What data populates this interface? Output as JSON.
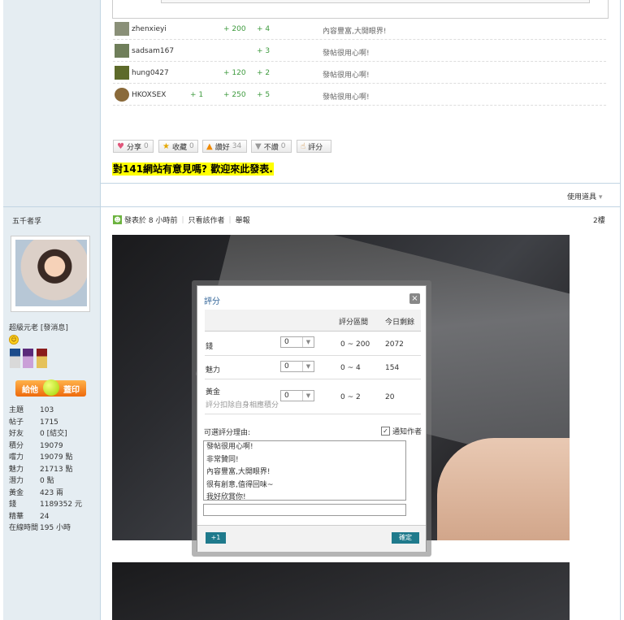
{
  "rating_rows": [
    {
      "name": "zhenxieyi",
      "c1": "",
      "c2": "+ 200",
      "c3": "+ 4",
      "reason": "內容豐富,大開眼界!",
      "avatar_color": "#8a9078"
    },
    {
      "name": "sadsam167",
      "c1": "",
      "c2": "",
      "c3": "+ 3",
      "reason": "發帖很用心啊!",
      "avatar_color": "#6f7e5a"
    },
    {
      "name": "hung0427",
      "c1": "",
      "c2": "+ 120",
      "c3": "+ 2",
      "reason": "發帖很用心啊!",
      "avatar_color": "#5d6a2a"
    },
    {
      "name": "HKOXSEX",
      "c1": "+ 1",
      "c2": "+ 250",
      "c3": "+ 5",
      "reason": "發帖很用心啊!",
      "avatar_color": "#8a6a3a"
    }
  ],
  "actions": {
    "share": {
      "label": "分享",
      "count": "0"
    },
    "favorite": {
      "label": "收藏",
      "count": "0"
    },
    "like": {
      "label": "讚好",
      "count": "34"
    },
    "dislike": {
      "label": "不讚",
      "count": "0"
    },
    "rate": {
      "label": "評分"
    }
  },
  "banner": "對141網站有意見嗎? 歡迎來此發表.",
  "tools_label": "使用道具",
  "user": {
    "name": "五千者孚",
    "group": "超級元老 [發消息]",
    "give_button": {
      "left": "給他",
      "right": "蓋印"
    },
    "stats": [
      {
        "label": "主題",
        "value": "103"
      },
      {
        "label": "帖子",
        "value": "1715"
      },
      {
        "label": "好友",
        "value": "0 [結交]"
      },
      {
        "label": "積分",
        "value": "19079"
      },
      {
        "label": "嚐力",
        "value": "19079 點"
      },
      {
        "label": "魅力",
        "value": "21713 點"
      },
      {
        "label": "潛力",
        "value": "0 點"
      },
      {
        "label": "黃金",
        "value": "423 兩"
      },
      {
        "label": "錢",
        "value": "1189352 元"
      },
      {
        "label": "精華",
        "value": "24"
      },
      {
        "label": "在線時間",
        "value": "195 小時"
      }
    ]
  },
  "post": {
    "posted": "發表於 8 小時前",
    "only_author": "只看該作者",
    "report": "舉報",
    "floor": "2樓"
  },
  "dialog": {
    "title": "評分",
    "close": "×",
    "col_range": "評分區間",
    "col_remain": "今日剩餘",
    "rows": [
      {
        "name": "錢",
        "value": "0",
        "range": "0 ~ 200",
        "remain": "2072",
        "sub": ""
      },
      {
        "name": "魅力",
        "value": "0",
        "range": "0 ~ 4",
        "remain": "154",
        "sub": ""
      },
      {
        "name": "黃金",
        "value": "0",
        "range": "0 ~ 2",
        "remain": "20",
        "sub": "評分扣除自身相應積分"
      }
    ],
    "reason_label": "可選評分理由:",
    "notify_label": "通知作者",
    "notify_checked": "✓",
    "reasons": [
      "發帖很用心啊!",
      "非常贊同!",
      "內容豐富,大開眼界!",
      "很有創意,值得回味~",
      "我好欣賞你!"
    ],
    "plus_one": "+1",
    "confirm": "確定"
  }
}
